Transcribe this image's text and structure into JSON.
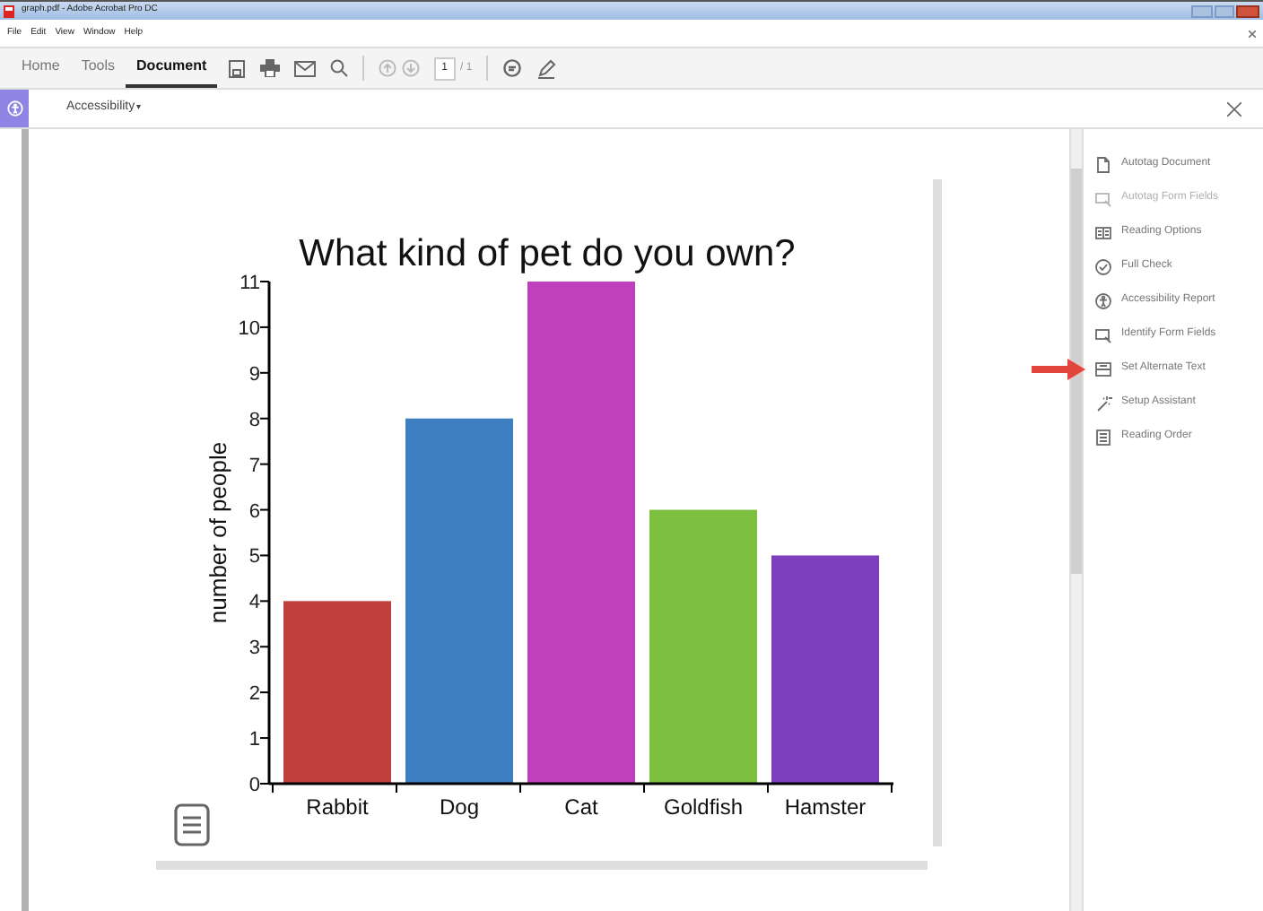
{
  "window": {
    "title": "graph.pdf - Adobe Acrobat Pro DC"
  },
  "menu": [
    "File",
    "Edit",
    "View",
    "Window",
    "Help"
  ],
  "tabs": [
    {
      "label": "Home",
      "selected": false
    },
    {
      "label": "Tools",
      "selected": false
    },
    {
      "label": "Document",
      "selected": true
    }
  ],
  "page_nav": {
    "value": "1",
    "total": "/ 1"
  },
  "tool_bar": {
    "title": "Accessibility",
    "caret": "▾"
  },
  "chart": {
    "chart_data": {
      "type": "bar",
      "title": "What kind of pet do you own?",
      "ylabel": "number of people",
      "categories": [
        "Rabbit",
        "Dog",
        "Cat",
        "Goldfish",
        "Hamster"
      ],
      "values": [
        4,
        8,
        11,
        6,
        5
      ],
      "colors": [
        "#c0403e",
        "#3d7fc1",
        "#bf3fbd",
        "#7dbf3f",
        "#7e3fbf"
      ],
      "ylim": [
        0,
        11
      ],
      "yticks": [
        0,
        1,
        2,
        3,
        4,
        5,
        6,
        7,
        8,
        9,
        10,
        11
      ]
    }
  },
  "panel": [
    {
      "label": "Autotag Document",
      "disabled": false,
      "kind": "doc"
    },
    {
      "label": "Autotag Form Fields",
      "disabled": true,
      "kind": "form"
    },
    {
      "label": "Reading Options",
      "disabled": false,
      "kind": "columns"
    },
    {
      "label": "Full Check",
      "disabled": false,
      "kind": "check"
    },
    {
      "label": "Accessibility Report",
      "disabled": false,
      "kind": "person"
    },
    {
      "label": "Identify Form Fields",
      "disabled": false,
      "kind": "form"
    },
    {
      "label": "Set Alternate Text",
      "disabled": false,
      "kind": "alt",
      "arrow": true
    },
    {
      "label": "Setup Assistant",
      "disabled": false,
      "kind": "wand"
    },
    {
      "label": "Reading Order",
      "disabled": false,
      "kind": "order"
    }
  ]
}
